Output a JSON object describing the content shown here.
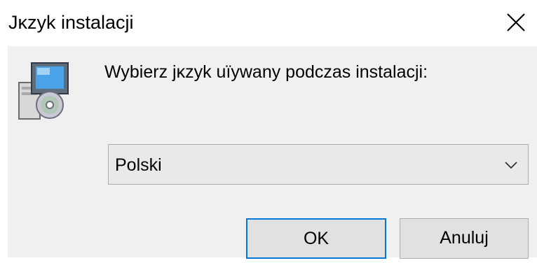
{
  "window": {
    "title": "Jκzyk instalacji",
    "close_icon": "close-icon"
  },
  "dialog": {
    "icon": "installer-setup-icon",
    "prompt": "Wybierz jκzyk uïywany podczas instalacji:",
    "language_select": {
      "selected": "Polski",
      "arrow_icon": "chevron-down-icon"
    },
    "buttons": {
      "ok_label": "OK",
      "cancel_label": "Anuluj"
    }
  },
  "colors": {
    "accent": "#0078d7",
    "client_background": "#f0f0f0",
    "button_face": "#e1e1e1"
  }
}
